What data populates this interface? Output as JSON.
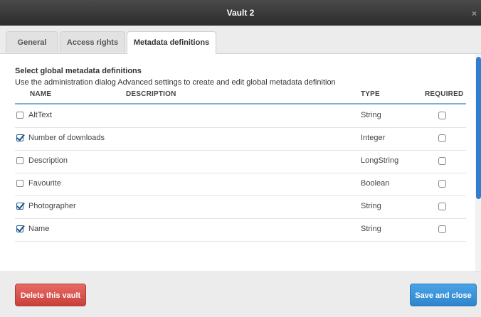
{
  "window": {
    "title": "Vault 2",
    "close_glyph": "×",
    "close_icon": "close-icon"
  },
  "tabs": [
    {
      "label": "General",
      "active": false
    },
    {
      "label": "Access rights",
      "active": false
    },
    {
      "label": "Metadata definitions",
      "active": true
    }
  ],
  "intro": {
    "heading": "Select global metadata definitions",
    "description": "Use the administration dialog Advanced settings to create and edit global metadata definition"
  },
  "table": {
    "columns": {
      "name": "NAME",
      "description": "DESCRIPTION",
      "type": "TYPE",
      "required": "REQUIRED"
    },
    "rows": [
      {
        "name": "AltText",
        "description": "",
        "type": "String",
        "selected": false,
        "required": false
      },
      {
        "name": "Number of downloads",
        "description": "",
        "type": "Integer",
        "selected": true,
        "required": false
      },
      {
        "name": "Description",
        "description": "",
        "type": "LongString",
        "selected": false,
        "required": false
      },
      {
        "name": "Favourite",
        "description": "",
        "type": "Boolean",
        "selected": false,
        "required": false
      },
      {
        "name": "Photographer",
        "description": "",
        "type": "String",
        "selected": true,
        "required": false
      },
      {
        "name": "Name",
        "description": "",
        "type": "String",
        "selected": true,
        "required": false
      }
    ]
  },
  "footer": {
    "delete_label": "Delete this vault",
    "save_label": "Save and close"
  },
  "colors": {
    "delete": "#d9534f",
    "save": "#3a95da",
    "header_rule": "#7fb0d9",
    "scrollbar": "#2f7fd0"
  }
}
